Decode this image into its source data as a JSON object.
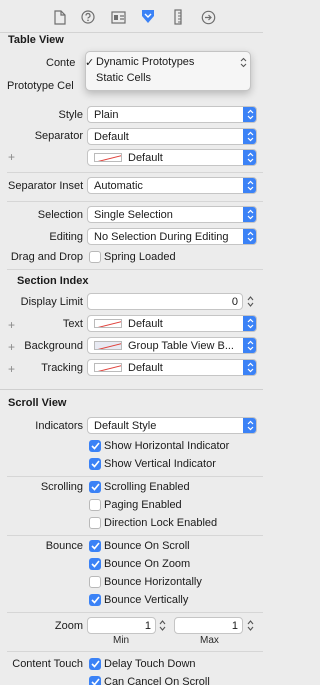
{
  "toolbar": {
    "icons": [
      "file-icon",
      "help-icon",
      "identity-icon",
      "attributes-icon",
      "ruler-icon",
      "connections-icon"
    ],
    "accent": "#3b82f6"
  },
  "table_view": {
    "section_title": "Table View",
    "content_label": "Conte",
    "prototype_label": "Prototype Cel",
    "style_label": "Style",
    "style_value": "Plain",
    "separator_label": "Separator",
    "separator_value": "Default",
    "separator_color_value": "Default",
    "separator_inset_label": "Separator Inset",
    "separator_inset_value": "Automatic",
    "selection_label": "Selection",
    "selection_value": "Single Selection",
    "editing_label": "Editing",
    "editing_value": "No Selection During Editing",
    "drag_drop_label": "Drag and Drop",
    "spring_loaded_label": "Spring Loaded",
    "spring_loaded_checked": false
  },
  "content_popup": {
    "items": [
      "Dynamic Prototypes",
      "Static Cells"
    ],
    "checkmark": "✓"
  },
  "section_index": {
    "title": "Section Index",
    "display_limit_label": "Display Limit",
    "display_limit_value": "0",
    "text_label": "Text",
    "text_value": "Default",
    "background_label": "Background",
    "background_value": "Group Table View B...",
    "tracking_label": "Tracking",
    "tracking_value": "Default"
  },
  "scroll_view": {
    "title": "Scroll View",
    "indicators_label": "Indicators",
    "indicators_value": "Default Style",
    "show_horizontal": "Show Horizontal Indicator",
    "show_vertical": "Show Vertical Indicator",
    "scrolling_label": "Scrolling",
    "scrolling_enabled": "Scrolling Enabled",
    "paging_enabled": "Paging Enabled",
    "direction_lock": "Direction Lock Enabled",
    "bounce_label": "Bounce",
    "bounce_on_scroll": "Bounce On Scroll",
    "bounce_on_zoom": "Bounce On Zoom",
    "bounce_horizontally": "Bounce Horizontally",
    "bounce_vertically": "Bounce Vertically",
    "zoom_label": "Zoom",
    "zoom_min_value": "1",
    "zoom_max_value": "1",
    "min_caption": "Min",
    "max_caption": "Max",
    "content_touch_label": "Content Touch",
    "delay_touch_down": "Delay Touch Down",
    "can_cancel": "Can Cancel On Scroll",
    "plus_symbol": "+"
  }
}
